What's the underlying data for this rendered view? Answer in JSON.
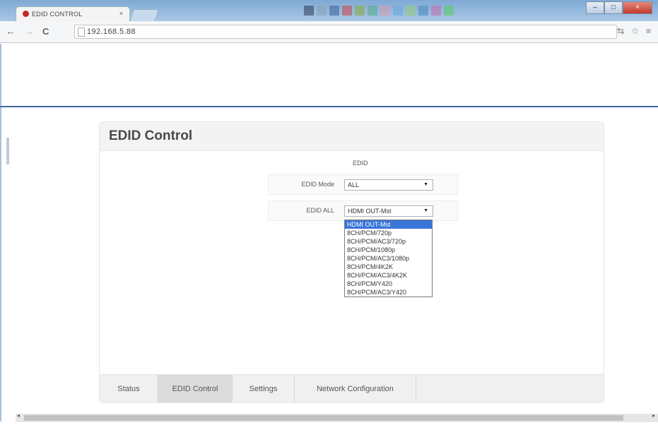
{
  "browser": {
    "tab_title": "EDID CONTROL",
    "tab_close": "×",
    "url": "192.168.5.88",
    "window_controls": {
      "minimize": "–",
      "maximize": "□",
      "close": "×"
    },
    "nav": {
      "back": "←",
      "forward": "→",
      "reload": "C"
    },
    "right_icons": {
      "translate": "⇆",
      "star": "☆",
      "menu": "≡"
    },
    "swatch_colors": [
      "#2a3a55",
      "#8aa0b8",
      "#3a5f8f",
      "#c44",
      "#8a3",
      "#5a8",
      "#d9a",
      "#6ad",
      "#9c7",
      "#48b",
      "#c6a",
      "#5c5"
    ]
  },
  "panel": {
    "title": "EDID Control",
    "section_label": "EDID",
    "edid_mode": {
      "label": "EDID Mode",
      "value": "ALL",
      "arrow": "▼"
    },
    "edid_all": {
      "label": "EDID ALL",
      "value": "HDMI OUT-Mst",
      "arrow": "▼"
    },
    "edid_options": [
      "HDMI OUT-Mst",
      "8CH/PCM/720p",
      "8CH/PCM/AC3/720p",
      "8CH/PCM/1080p",
      "8CH/PCM/AC3/1080p",
      "8CH/PCM/4K2K",
      "8CH/PCM/AC3/4K2K",
      "8CH/PCM/Y420",
      "8CH/PCM/AC3/Y420"
    ],
    "selected_option_index": 0
  },
  "bottom_nav": {
    "tabs": [
      "Status",
      "EDID Control",
      "Settings",
      "Network Configuration"
    ],
    "active": "EDID Control"
  },
  "scrollbar": {
    "left_arrow": "◂",
    "right_arrow": "▸"
  }
}
